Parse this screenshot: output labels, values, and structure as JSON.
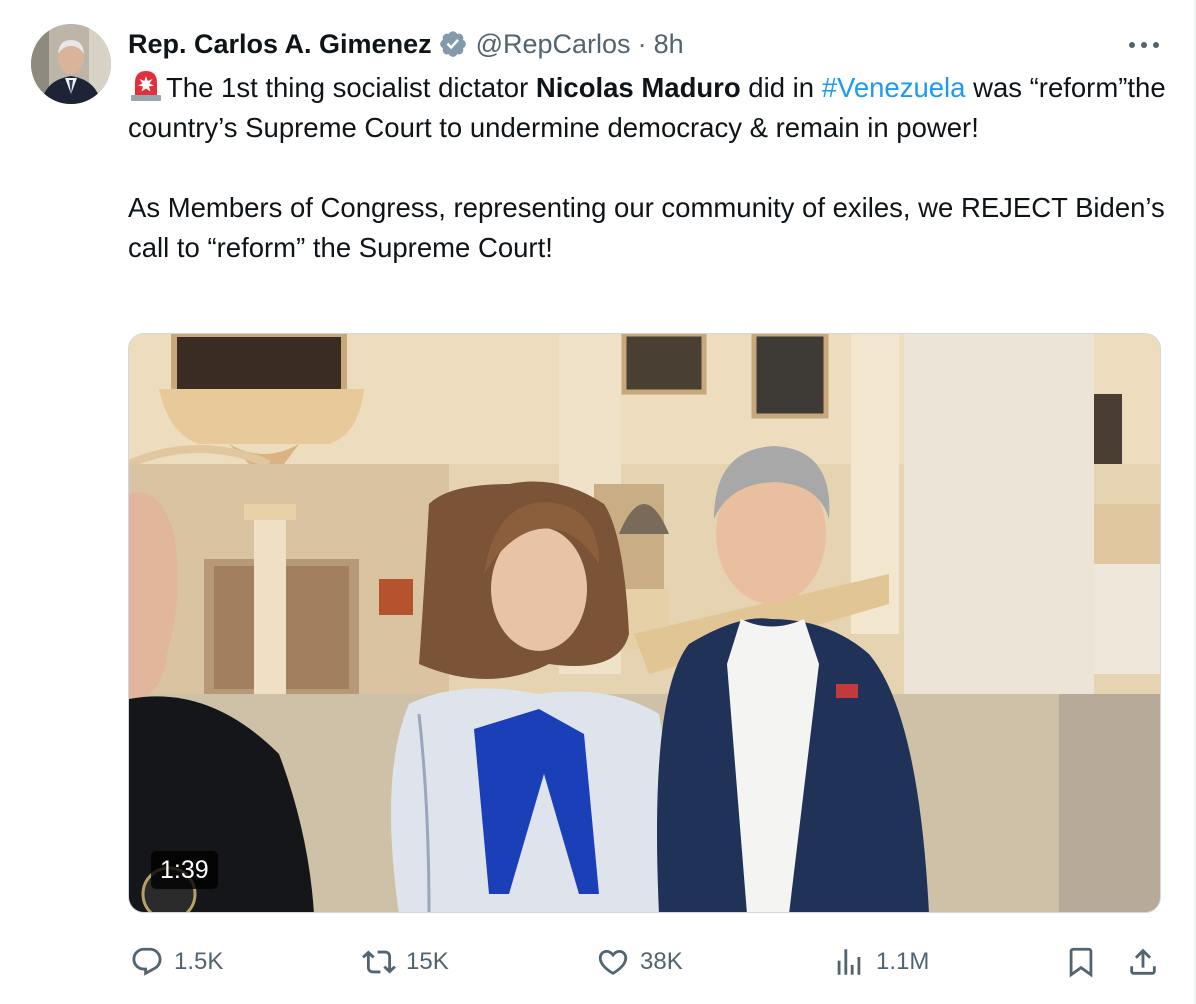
{
  "tweet": {
    "author_name": "Rep. Carlos A. Gimenez",
    "handle": "@RepCarlos",
    "separator": "·",
    "time": "8h",
    "text": {
      "p1_a": "The 1st thing socialist dictator ",
      "p1_bold": "Nicolas Maduro",
      "p1_b": " did in ",
      "p1_hashtag": "#Venezuela",
      "p1_c": " was “reform”the country’s Supreme Court to undermine democracy & remain in power!",
      "p2": "As Members of Congress, representing our community of exiles, we REJECT Biden’s call to “reform” the Supreme Court!"
    },
    "video": {
      "duration": "1:39"
    }
  },
  "actions": {
    "replies": "1.5K",
    "reposts": "15K",
    "likes": "38K",
    "views": "1.1M"
  },
  "icons": {
    "verified": "verified-badge-icon",
    "more": "more-dots-icon",
    "siren": "rotating-light-emoji-icon",
    "reply": "reply-icon",
    "repost": "repost-icon",
    "like": "heart-icon",
    "views": "views-chart-icon",
    "bookmark": "bookmark-icon",
    "share": "share-icon"
  },
  "colors": {
    "accent": "#1d9bf0",
    "muted": "#536471",
    "text": "#0f1419"
  }
}
